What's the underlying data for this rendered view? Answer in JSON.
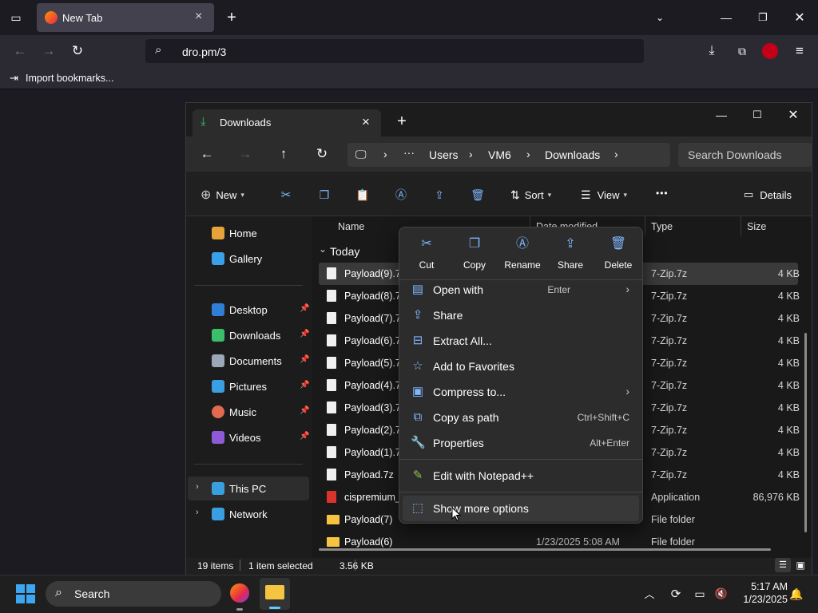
{
  "browser": {
    "tab_title": "New Tab",
    "url": "dro.pm/3",
    "bookmark_item": "Import bookmarks..."
  },
  "explorer": {
    "tab_title": "Downloads",
    "breadcrumb": [
      "Users",
      "VM6",
      "Downloads"
    ],
    "search_placeholder": "Search Downloads",
    "cmd": {
      "new": "New",
      "sort": "Sort",
      "view": "View",
      "more": "•••",
      "details": "Details"
    },
    "nav_pane": [
      {
        "label": "Home",
        "color": "#e8a33a"
      },
      {
        "label": "Gallery",
        "color": "#3aa0e8"
      },
      {
        "label": "Desktop",
        "color": "#2f7fd6"
      },
      {
        "label": "Downloads",
        "color": "#3cbf6a"
      },
      {
        "label": "Documents",
        "color": "#9aa8b8"
      },
      {
        "label": "Pictures",
        "color": "#3a9fe0"
      },
      {
        "label": "Music",
        "color": "#e26a4f"
      },
      {
        "label": "Videos",
        "color": "#8e5ad6"
      },
      {
        "label": "This PC",
        "color": "#3a9fe0"
      },
      {
        "label": "Network",
        "color": "#3a9fe0"
      }
    ],
    "columns": {
      "name": "Name",
      "date": "Date modified",
      "type": "Type",
      "size": "Size"
    },
    "group_label": "Today",
    "files": [
      {
        "name": "Payload(9).7z",
        "date": "",
        "type": "7-Zip.7z",
        "size": "4 KB"
      },
      {
        "name": "Payload(8).7z",
        "date": "",
        "type": "7-Zip.7z",
        "size": "4 KB"
      },
      {
        "name": "Payload(7).7z",
        "date": "",
        "type": "7-Zip.7z",
        "size": "4 KB"
      },
      {
        "name": "Payload(6).7z",
        "date": "",
        "type": "7-Zip.7z",
        "size": "4 KB"
      },
      {
        "name": "Payload(5).7z",
        "date": "",
        "type": "7-Zip.7z",
        "size": "4 KB"
      },
      {
        "name": "Payload(4).7z",
        "date": "",
        "type": "7-Zip.7z",
        "size": "4 KB"
      },
      {
        "name": "Payload(3).7z",
        "date": "",
        "type": "7-Zip.7z",
        "size": "4 KB"
      },
      {
        "name": "Payload(2).7z",
        "date": "",
        "type": "7-Zip.7z",
        "size": "4 KB"
      },
      {
        "name": "Payload(1).7z",
        "date": "",
        "type": "7-Zip.7z",
        "size": "4 KB"
      },
      {
        "name": "Payload.7z",
        "date": "",
        "type": "7-Zip.7z",
        "size": "4 KB"
      },
      {
        "name": "cispremium_",
        "date": "",
        "type": "Application",
        "size": "86,976 KB"
      },
      {
        "name": "Payload(7)",
        "date": "",
        "type": "File folder",
        "size": ""
      },
      {
        "name": "Payload(6)",
        "date": "1/23/2025 5:08 AM",
        "type": "File folder",
        "size": ""
      }
    ],
    "status": {
      "items": "19 items",
      "selected": "1 item selected",
      "size": "3.56 KB"
    }
  },
  "context_menu": {
    "top_actions": [
      "Cut",
      "Copy",
      "Rename",
      "Share",
      "Delete"
    ],
    "items": [
      {
        "label": "Open with",
        "shortcut": "Enter",
        "submenu": true
      },
      {
        "label": "Share",
        "shortcut": "",
        "submenu": false
      },
      {
        "label": "Extract All...",
        "shortcut": "",
        "submenu": false
      },
      {
        "label": "Add to Favorites",
        "shortcut": "",
        "submenu": false
      },
      {
        "label": "Compress to...",
        "shortcut": "",
        "submenu": true
      },
      {
        "label": "Copy as path",
        "shortcut": "Ctrl+Shift+C",
        "submenu": false
      },
      {
        "label": "Properties",
        "shortcut": "Alt+Enter",
        "submenu": false
      },
      {
        "label": "Edit with Notepad++",
        "shortcut": "",
        "submenu": false
      },
      {
        "label": "Show more options",
        "shortcut": "",
        "submenu": false
      }
    ]
  },
  "taskbar": {
    "search_label": "Search",
    "time": "5:17 AM",
    "date": "1/23/2025"
  }
}
